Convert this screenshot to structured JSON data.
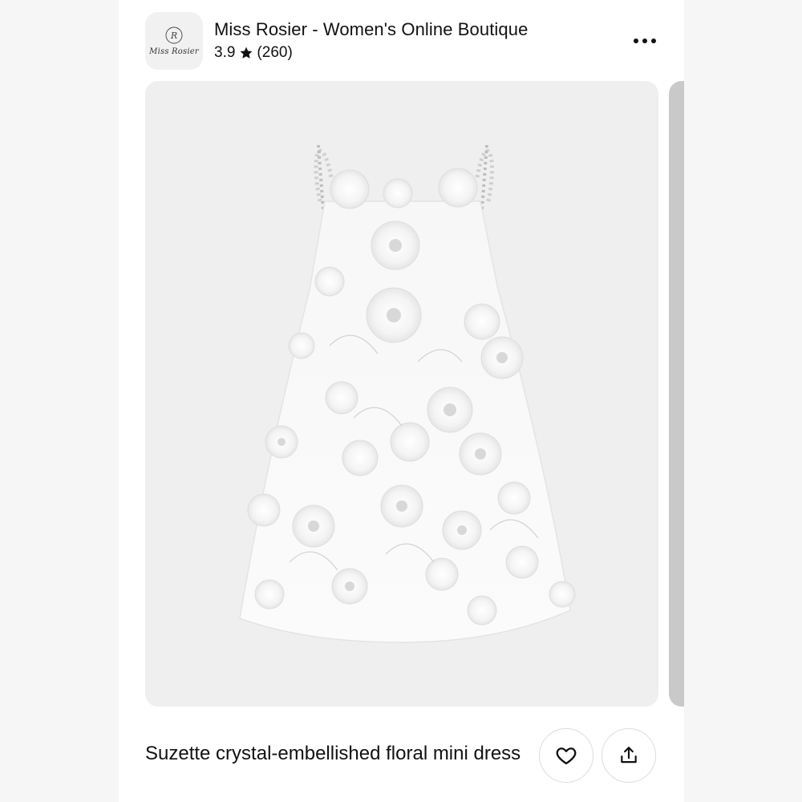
{
  "store": {
    "logo_text": "Miss Rosier",
    "logo_monogram": "R",
    "name": "Miss Rosier - Women's Online Boutique",
    "rating": "3.9",
    "review_count": "(260)"
  },
  "icons": {
    "rating": "star-icon",
    "more": "more-horizontal-icon",
    "like": "heart-icon",
    "share": "share-icon"
  },
  "product": {
    "image": "white crystal-embellished floral mini dress photo",
    "title": "Suzette crystal-embellished floral mini dress"
  },
  "colors": {
    "text": "#111111",
    "card_background": "#efefef",
    "page_background": "#ffffff"
  }
}
